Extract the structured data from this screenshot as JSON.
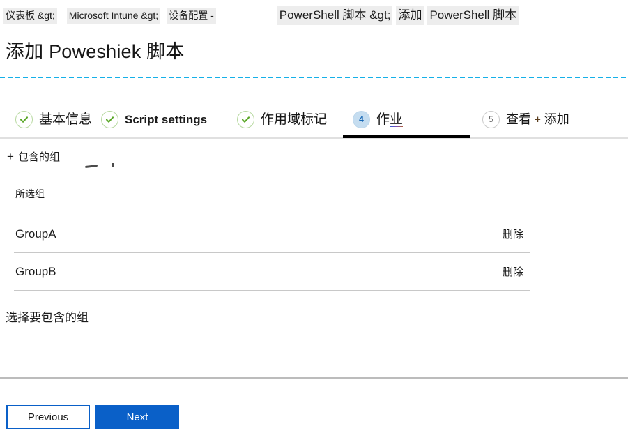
{
  "breadcrumb": {
    "items": [
      {
        "label": "仪表板 &gt;",
        "size": "small"
      },
      {
        "label": "Microsoft Intune &gt;",
        "size": "small"
      },
      {
        "label": "设备配置 -",
        "size": "small"
      },
      {
        "label": "PowerShell 脚本 &gt;",
        "size": "big"
      },
      {
        "label": "添加",
        "size": "big"
      },
      {
        "label": "PowerShell 脚本",
        "size": "big"
      }
    ]
  },
  "page": {
    "title": "添加 Poweshiek 脚本"
  },
  "wizard": {
    "steps": [
      {
        "number": "1",
        "label": "基本信息",
        "state": "done",
        "icon": "check-icon"
      },
      {
        "number": "2",
        "label": "Script settings",
        "state": "done",
        "icon": "check-icon"
      },
      {
        "number": "3",
        "label": "作用域标记",
        "state": "done",
        "icon": "check-icon"
      },
      {
        "number": "4",
        "label_prefix": "作",
        "label_suffix": "业",
        "label": "作业",
        "state": "active"
      },
      {
        "number": "5",
        "label_prefix": "查看 ",
        "plus": "+",
        "label_suffix": " 添加",
        "label": "查看 + 添加",
        "state": "pending"
      }
    ]
  },
  "content": {
    "add_group_plus": "+",
    "add_group_label": "包含的组",
    "selected_groups_header": "所选组",
    "groups": [
      {
        "name": "GroupA",
        "delete_label": "删除"
      },
      {
        "name": "GroupB",
        "delete_label": "删除"
      }
    ],
    "choose_hint": "选择要包含的组"
  },
  "footer": {
    "previous_label": "Previous",
    "next_label": "Next"
  },
  "colors": {
    "primary_blue": "#0a60c8",
    "accent_dashed": "#16b0e8",
    "active_step_fill": "#c5ddf0",
    "active_step_text": "#1667b5",
    "done_check": "#5ba829",
    "divider": "#c8c8c8"
  }
}
